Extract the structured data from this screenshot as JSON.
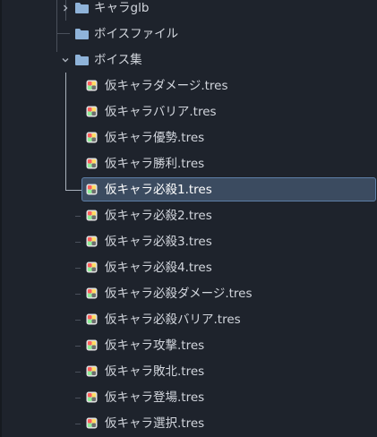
{
  "tree": {
    "folders": [
      {
        "label": "キャラglb",
        "expanded": false,
        "has_arrow": true
      },
      {
        "label": "ボイスファイル",
        "expanded": false,
        "has_arrow": false
      },
      {
        "label": "ボイス集",
        "expanded": true,
        "has_arrow": true
      }
    ],
    "files": [
      {
        "label": "仮キャラダメージ.tres",
        "selected": false
      },
      {
        "label": "仮キャラバリア.tres",
        "selected": false
      },
      {
        "label": "仮キャラ優勢.tres",
        "selected": false
      },
      {
        "label": "仮キャラ勝利.tres",
        "selected": false
      },
      {
        "label": "仮キャラ必殺1.tres",
        "selected": true
      },
      {
        "label": "仮キャラ必殺2.tres",
        "selected": false
      },
      {
        "label": "仮キャラ必殺3.tres",
        "selected": false
      },
      {
        "label": "仮キャラ必殺4.tres",
        "selected": false
      },
      {
        "label": "仮キャラ必殺ダメージ.tres",
        "selected": false
      },
      {
        "label": "仮キャラ必殺バリア.tres",
        "selected": false
      },
      {
        "label": "仮キャラ攻撃.tres",
        "selected": false
      },
      {
        "label": "仮キャラ敗北.tres",
        "selected": false
      },
      {
        "label": "仮キャラ登場.tres",
        "selected": false
      },
      {
        "label": "仮キャラ選択.tres",
        "selected": false
      }
    ]
  },
  "colors": {
    "background": "#1e232c",
    "text": "#d2d6dd",
    "folder": "#8fb3d9",
    "selection": "#3b4b60",
    "selection_border": "#5d7ea6",
    "guide_line": "#4a505b"
  },
  "icons": {
    "folder": "folder-icon",
    "resource": "resource-file-icon",
    "collapsed": "chevron-right-icon",
    "expanded": "chevron-down-icon"
  }
}
